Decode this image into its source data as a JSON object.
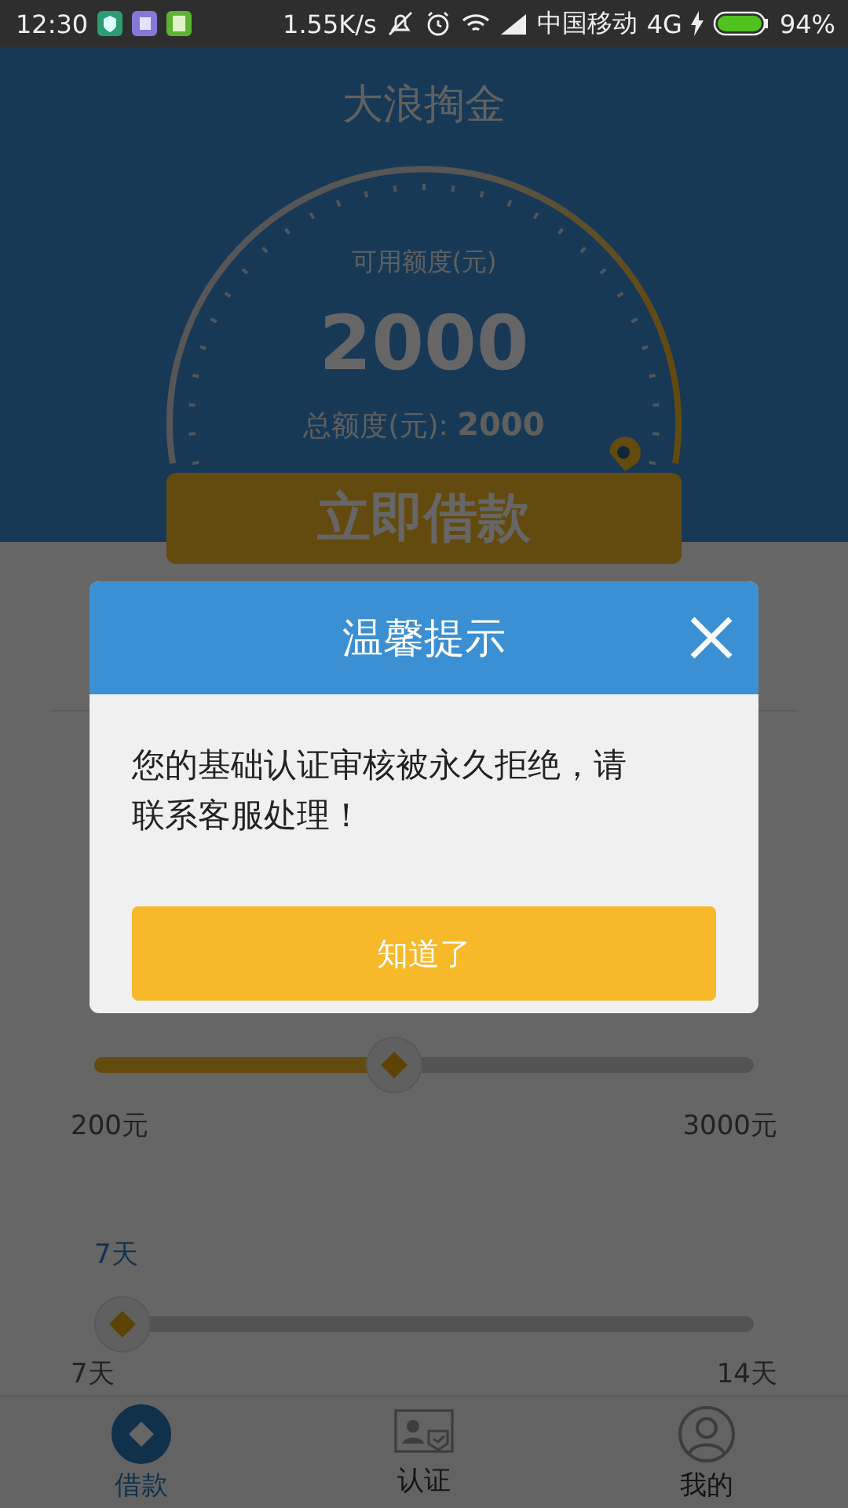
{
  "status_bar": {
    "time": "12:30",
    "net_speed": "1.55K/s",
    "carrier": "中国移动",
    "network": "4G",
    "battery": "94%"
  },
  "header": {
    "title": "大浪掏金",
    "available_label": "可用额度(元)",
    "available_amount": "2000",
    "total": "总额度(元): **2000**",
    "loan_button": "立即借款"
  },
  "amount_slider": {
    "level": 0.45,
    "min_label": "200元",
    "max_label": "3000元"
  },
  "term_value": "7天",
  "term_slider": {
    "level": 0,
    "min_label": "7天",
    "max_label": "14天"
  },
  "nav": [
    {
      "label": "借款",
      "kind": "coin",
      "selected": true
    },
    {
      "label": "认证",
      "kind": "id-card",
      "selected": false
    },
    {
      "label": "我的",
      "kind": "person",
      "selected": false
    }
  ],
  "dialog": {
    "title": "温馨提示",
    "message": "您的基础认证审核被永久拒绝，请联系客服处理！",
    "button": "知道了"
  }
}
